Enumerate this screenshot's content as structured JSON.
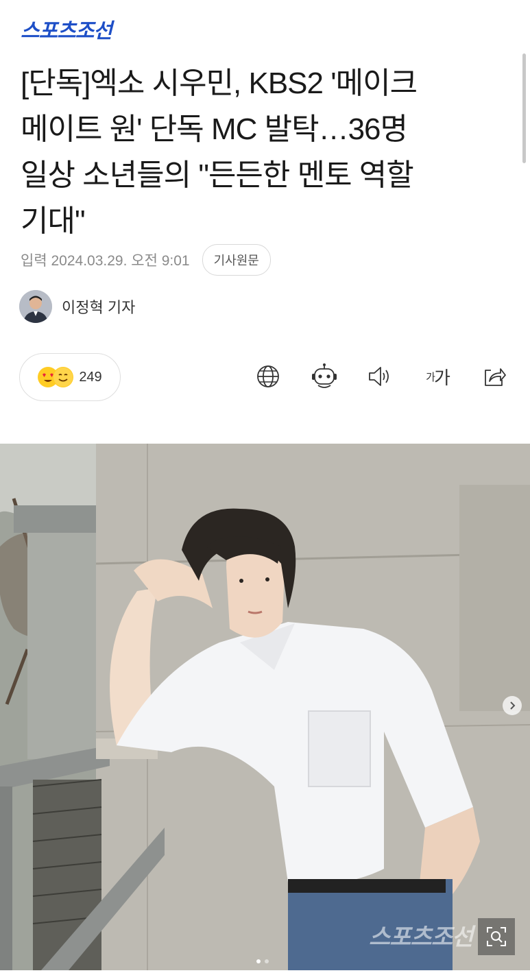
{
  "header": {
    "logo_text": "스포츠조선"
  },
  "article": {
    "title_lines": [
      "[단독]엑소 시우민, KBS2 '메이크",
      "메이트 원' 단독 MC 발탁…36명",
      "일상 소년들의 \"든든한 멘토 역할",
      "기대\""
    ],
    "date": "입력 2024.03.29. 오전 9:01",
    "original_button": "기사원문",
    "author": "이정혁 기자"
  },
  "toolbar": {
    "reaction_count": "249",
    "font_size_label_small": "가",
    "font_size_label_large": "가"
  },
  "photo": {
    "watermark": "스포츠조선",
    "slide_count": 2,
    "active_slide": 1
  },
  "colors": {
    "brand": "#1e4fc7",
    "meta": "#8a8a8a"
  }
}
